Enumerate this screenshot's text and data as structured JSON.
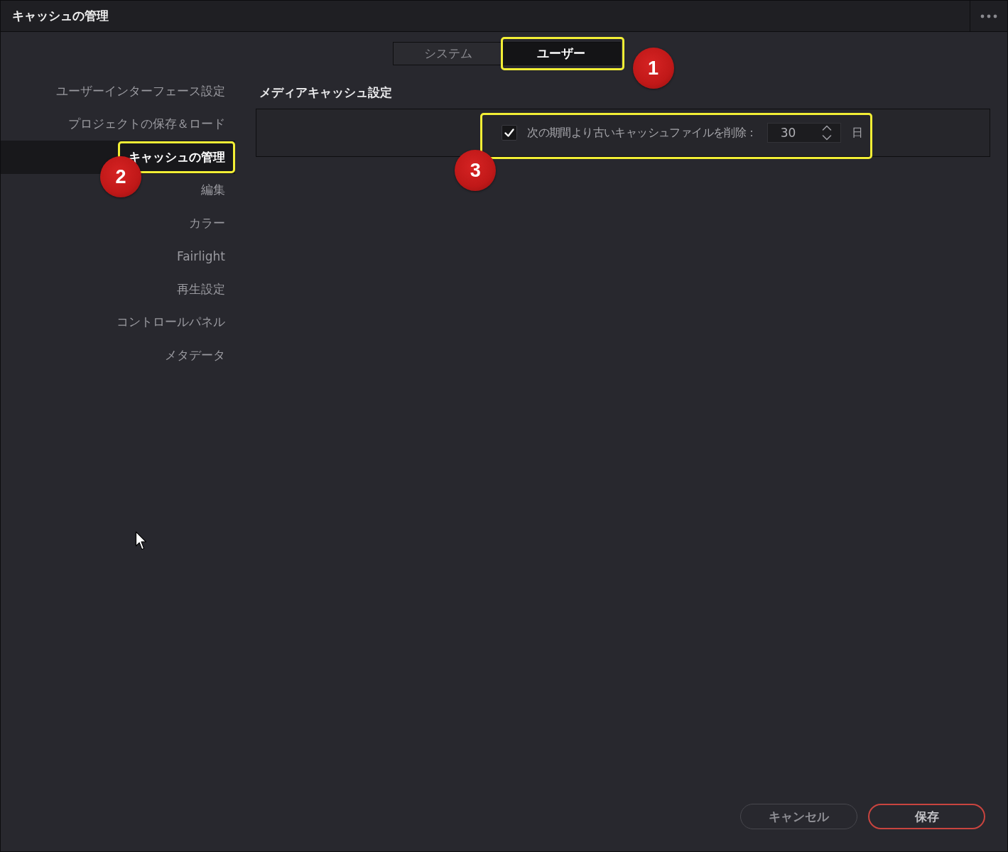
{
  "window": {
    "title": "キャッシュの管理"
  },
  "tabs": [
    {
      "label": "システム",
      "selected": false,
      "highlighted": false
    },
    {
      "label": "ユーザー",
      "selected": true,
      "highlighted": true,
      "callout": "1"
    }
  ],
  "sidebar": {
    "items": [
      {
        "label": "ユーザーインターフェース設定",
        "selected": false,
        "highlighted": false
      },
      {
        "label": "プロジェクトの保存＆ロード",
        "selected": false,
        "highlighted": false
      },
      {
        "label": "キャッシュの管理",
        "selected": true,
        "highlighted": true,
        "callout": "2"
      },
      {
        "label": "編集",
        "selected": false,
        "highlighted": false
      },
      {
        "label": "カラー",
        "selected": false,
        "highlighted": false
      },
      {
        "label": "Fairlight",
        "selected": false,
        "highlighted": false
      },
      {
        "label": "再生設定",
        "selected": false,
        "highlighted": false
      },
      {
        "label": "コントロールパネル",
        "selected": false,
        "highlighted": false
      },
      {
        "label": "メタデータ",
        "selected": false,
        "highlighted": false
      }
    ]
  },
  "section": {
    "title": "メディアキャッシュ設定",
    "settings": [
      {
        "kind": "checkbox-number",
        "label": "次の期間より古いキャッシュファイルを削除：",
        "checked": true,
        "value": "30",
        "unit": "日",
        "highlighted": true,
        "callout": "3"
      }
    ]
  },
  "buttons": [
    {
      "label": "キャンセル",
      "kind": "secondary"
    },
    {
      "label": "保存",
      "kind": "primary"
    }
  ]
}
